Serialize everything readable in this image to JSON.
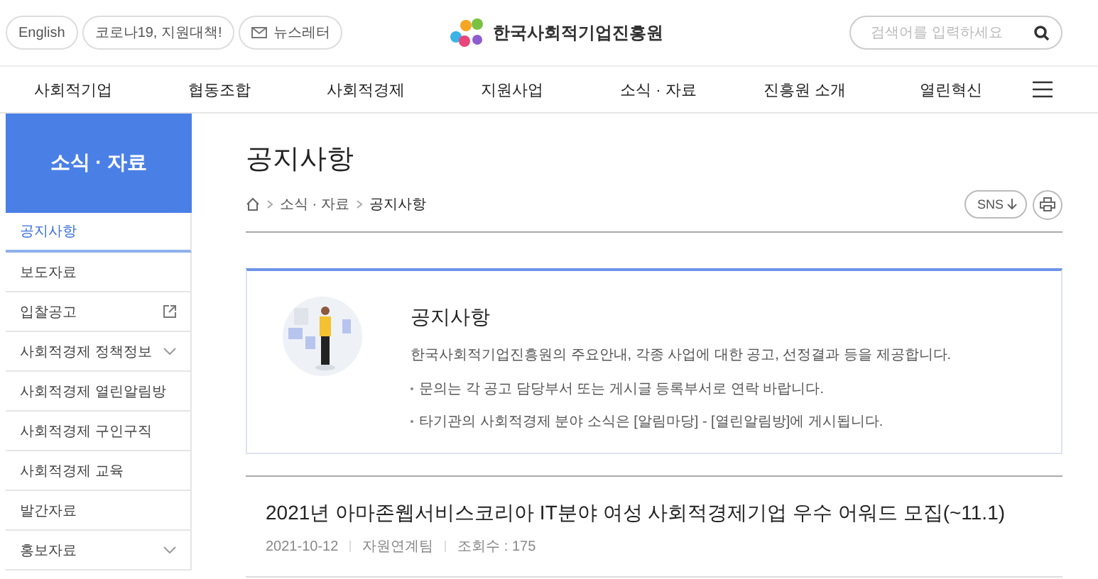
{
  "top_links": [
    {
      "kind": "text",
      "label": "English"
    },
    {
      "kind": "text",
      "label": "코로나19, 지원대책!"
    },
    {
      "kind": "mail",
      "label": "뉴스레터"
    }
  ],
  "logo": {
    "name": "한국사회적기업진흥원"
  },
  "search": {
    "placeholder": "검색어를 입력하세요"
  },
  "nav": [
    "사회적기업",
    "협동조합",
    "사회적경제",
    "지원사업",
    "소식 · 자료",
    "진흥원 소개",
    "열린혁신"
  ],
  "sidebar": {
    "title": "소식 · 자료",
    "items": [
      {
        "label": "공지사항",
        "kind": "plain",
        "selected": true
      },
      {
        "label": "보도자료",
        "kind": "plain",
        "selected": false
      },
      {
        "label": "입찰공고",
        "kind": "external",
        "selected": false
      },
      {
        "label": "사회적경제 정책정보",
        "kind": "expandable",
        "selected": false
      },
      {
        "label": "사회적경제 열린알림방",
        "kind": "plain",
        "selected": false
      },
      {
        "label": "사회적경제 구인구직",
        "kind": "plain",
        "selected": false
      },
      {
        "label": "사회적경제 교육",
        "kind": "plain",
        "selected": false
      },
      {
        "label": "발간자료",
        "kind": "plain",
        "selected": false
      },
      {
        "label": "홍보자료",
        "kind": "expandable",
        "selected": false
      }
    ]
  },
  "page_title": "공지사항",
  "breadcrumb": [
    "소식 · 자료",
    "공지사항"
  ],
  "sns_button": "SNS",
  "intro": {
    "title": "공지사항",
    "description": "한국사회적기업진흥원의 주요안내, 각종 사업에 대한 공고, 선정결과 등을 제공합니다.",
    "notes": [
      "문의는 각 공고 담당부서 또는 게시글 등록부서로 연락 바랍니다.",
      "타기관의 사회적경제 분야 소식은 [알림마당] - [열린알림방]에 게시됩니다."
    ]
  },
  "posts": [
    {
      "title": "2021년 아마존웹서비스코리아 IT분야 여성 사회적경제기업 우수 어워드 모집(~11.1)",
      "date": "2021-10-12",
      "department": "자원연계팀",
      "views": "조회수 : 175"
    }
  ]
}
